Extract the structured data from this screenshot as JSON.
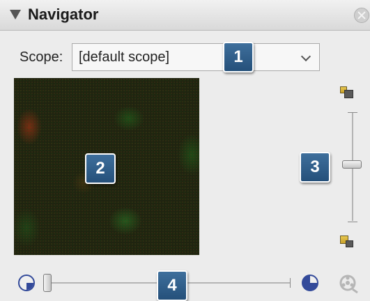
{
  "panel": {
    "title": "Navigator",
    "collapse_icon": "triangle-down-icon",
    "close_icon": "close-circle-icon"
  },
  "scope": {
    "label": "Scope:",
    "selected": "[default scope]"
  },
  "preview": {
    "description_icon": "image-preview"
  },
  "zoom": {
    "top_icon": "zoom-in-icon",
    "bottom_icon": "zoom-out-icon",
    "level": 0.55
  },
  "time": {
    "start_icon": "clock-start-icon",
    "end_icon": "clock-end-icon",
    "movie_icon": "film-reel-icon",
    "position": 0.0
  },
  "callouts": [
    "1",
    "2",
    "3",
    "4"
  ],
  "colors": {
    "callout_fill": "#2f5f8c",
    "header_text": "#1a1a1a",
    "clock_blue": "#334a9a"
  }
}
